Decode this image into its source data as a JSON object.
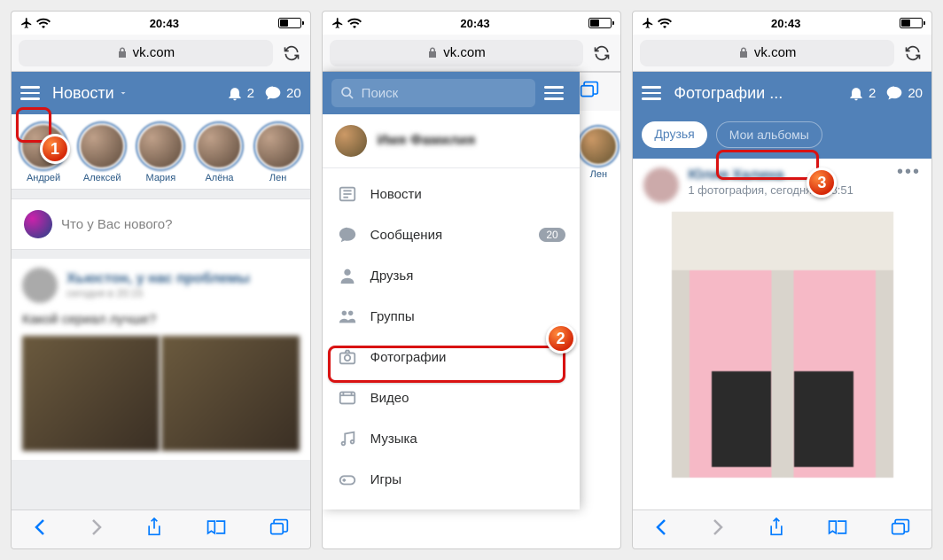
{
  "status": {
    "time": "20:43"
  },
  "url": "vk.com",
  "screen1": {
    "title": "Новости",
    "bell_count": "2",
    "chat_count": "20",
    "stories": [
      "Андрей",
      "Алексей",
      "Мария",
      "Алёна",
      "Лен"
    ],
    "composer_placeholder": "Что у Вас нового?",
    "feed": {
      "text": "Какой сериал лучше?"
    }
  },
  "screen2": {
    "search_placeholder": "Поиск",
    "menu": {
      "news": "Новости",
      "messages": "Сообщения",
      "messages_count": "20",
      "friends": "Друзья",
      "groups": "Группы",
      "photos": "Фотографии",
      "video": "Видео",
      "music": "Музыка",
      "games": "Игры"
    },
    "story_visible": "Лен"
  },
  "screen3": {
    "title": "Фотографии ...",
    "bell_count": "2",
    "chat_count": "20",
    "tab_friends": "Друзья",
    "tab_albums": "Мои альбомы",
    "photo_meta": "1 фотография, сегодня в 18:51"
  },
  "annotations": {
    "n1": "1",
    "n2": "2",
    "n3": "3"
  }
}
